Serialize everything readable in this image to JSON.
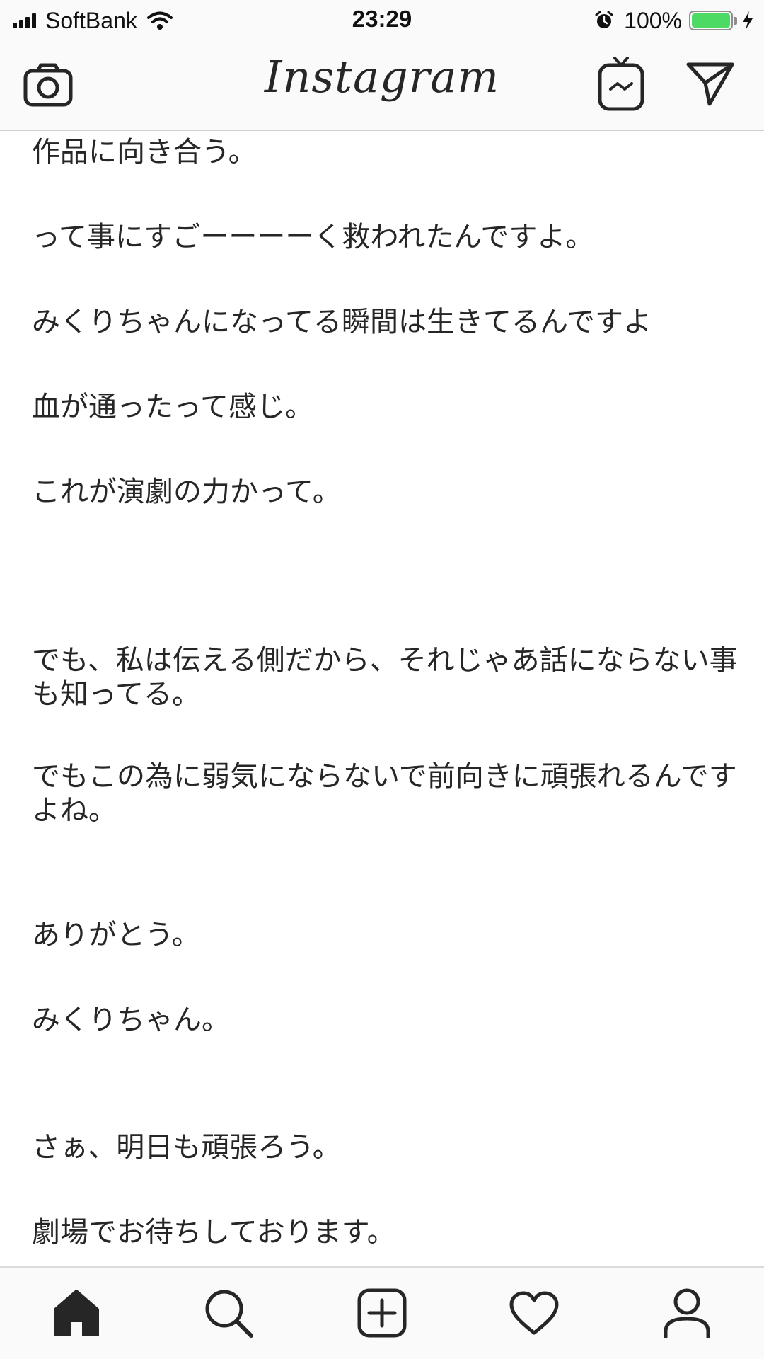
{
  "status_bar": {
    "carrier": "SoftBank",
    "time": "23:29",
    "battery_percent": "100%",
    "battery_level": 1.0,
    "icons": [
      "signal-icon",
      "wifi-icon",
      "alarm-icon",
      "battery-icon",
      "charging-icon"
    ]
  },
  "header": {
    "logo_text": "Instagram",
    "icons": [
      "camera-icon",
      "igtv-icon",
      "direct-message-icon"
    ]
  },
  "post": {
    "lines": [
      "作品に向き合う。",
      "って事にすごーーーーく救われたんですよ。",
      "みくりちゃんになってる瞬間は生きてるんですよ",
      "血が通ったって感じ。",
      "これが演劇の力かって。",
      "でも、私は伝える側だから、それじゃあ話にならない事も知ってる。",
      "でもこの為に弱気にならないで前向きに頑張れるんですよね。",
      "ありがとう。",
      "みくりちゃん。",
      "さぁ、明日も頑張ろう。",
      "劇場でお待ちしております。"
    ]
  },
  "bottom_nav": {
    "items": [
      "home-icon",
      "search-icon",
      "add-post-icon",
      "activity-heart-icon",
      "profile-icon"
    ]
  },
  "colors": {
    "bar_background": "#fafafa",
    "text": "#262626",
    "battery_green": "#4cd964"
  }
}
